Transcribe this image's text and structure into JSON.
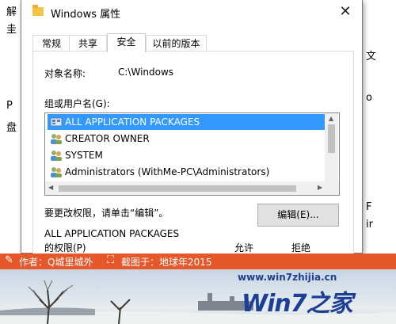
{
  "background": {
    "fragment_left_top": "解",
    "fragment_left_2": "圭",
    "fragment_left_3": "P",
    "fragment_left_4": "盘",
    "fragment_right_1": "文",
    "fragment_right_2": "o",
    "fragment_right_3": "F",
    "fragment_right_4": "ir"
  },
  "dialog": {
    "title": "Windows 属性",
    "close_glyph": "✕",
    "tabs": [
      {
        "label": "常规",
        "selected": false
      },
      {
        "label": "共享",
        "selected": false
      },
      {
        "label": "安全",
        "selected": true
      },
      {
        "label": "以前的版本",
        "selected": false
      }
    ],
    "object_name_label": "对象名称:",
    "object_name_value": "C:\\Windows",
    "groups_label": "组或用户名(G):",
    "groups": [
      {
        "name": "ALL APPLICATION PACKAGES",
        "icon": "app-packages-icon",
        "selected": true
      },
      {
        "name": "CREATOR OWNER",
        "icon": "users-icon",
        "selected": false
      },
      {
        "name": "SYSTEM",
        "icon": "users-icon",
        "selected": false
      },
      {
        "name": "Administrators (WithMe-PC\\Administrators)",
        "icon": "users-icon",
        "selected": false
      }
    ],
    "change_hint": "要更改权限，请单击“编辑”。",
    "edit_button": "编辑(E)...",
    "permissions_for": "ALL APPLICATION PACKAGES",
    "permissions_label": "的权限(P)",
    "allow_header": "允许",
    "deny_header": "拒绝"
  },
  "watermark": {
    "author": "作者：Q城里城外",
    "screenshot": "截图于：地球年2015",
    "site": "www.win7zhijia.cn",
    "logo": "Win7之家",
    "accent_color": "#e6582a"
  }
}
